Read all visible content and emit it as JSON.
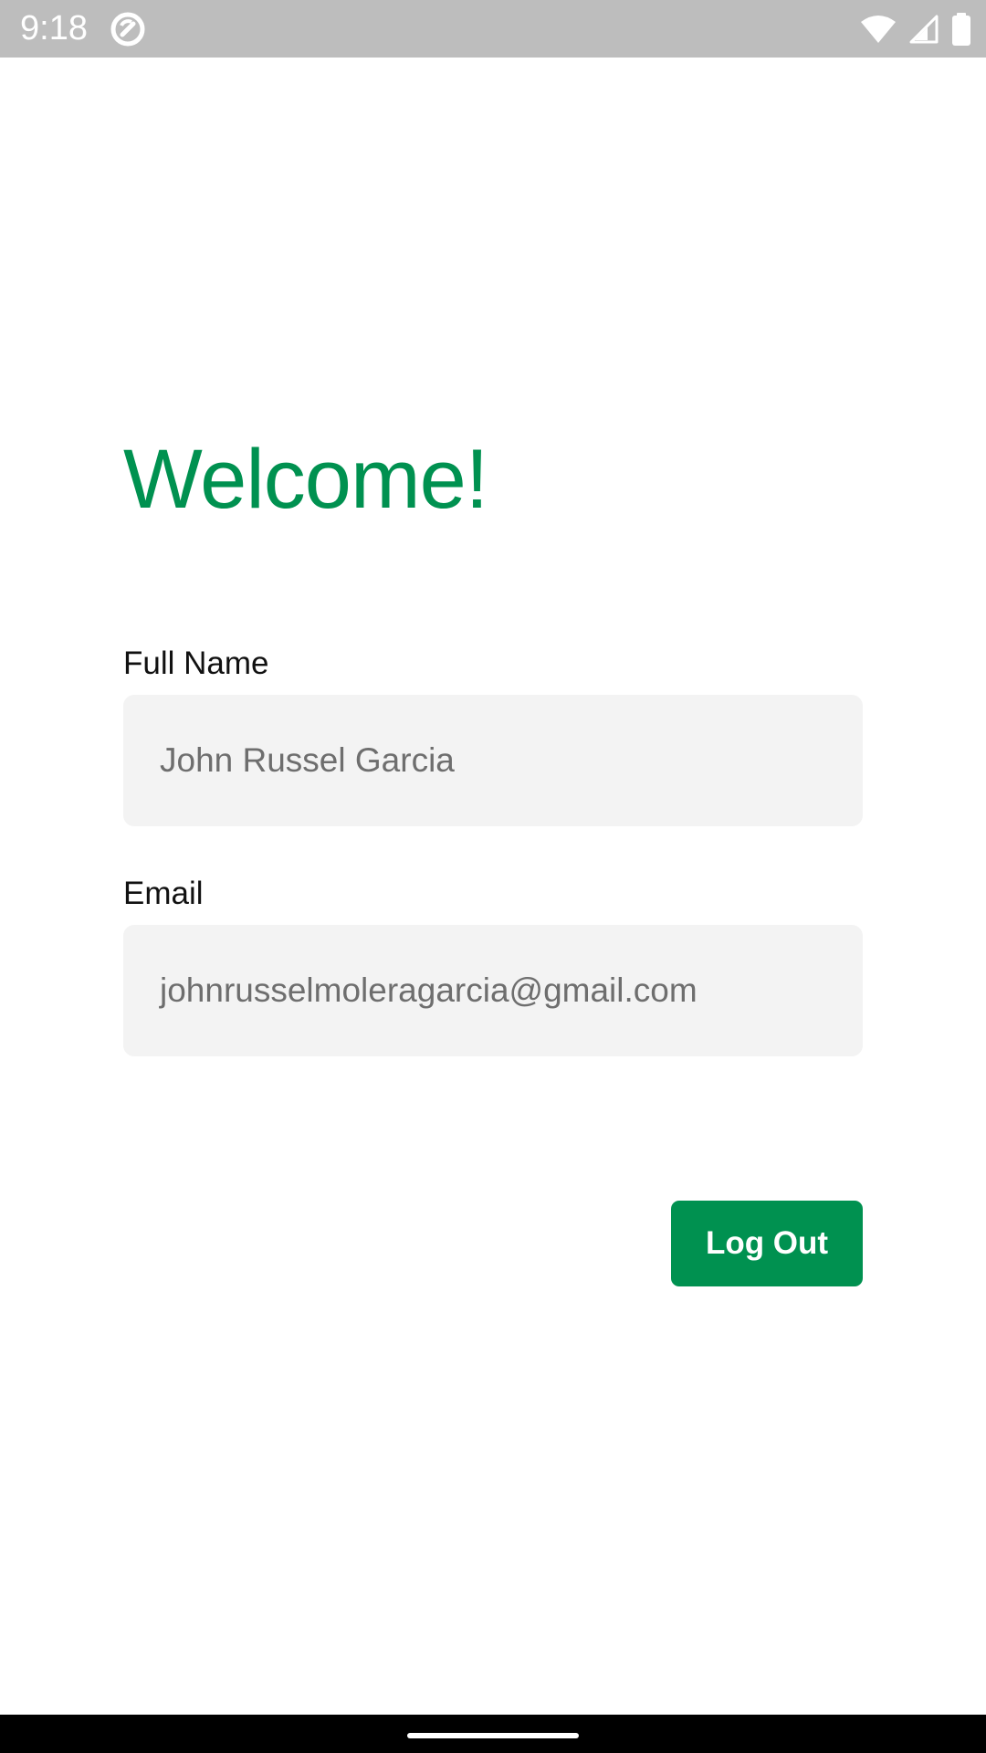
{
  "status_bar": {
    "time": "9:18",
    "app_icon": "no-sync-icon",
    "icons": [
      "wifi-icon",
      "signal-icon",
      "battery-icon"
    ]
  },
  "main": {
    "title": "Welcome!",
    "fields": [
      {
        "label": "Full Name",
        "value": "John Russel Garcia"
      },
      {
        "label": "Email",
        "value": "johnrusselmoleragarcia@gmail.com"
      }
    ],
    "logout_label": "Log Out"
  },
  "colors": {
    "accent": "#009150",
    "field_background": "#f3f3f3",
    "status_bar": "#bdbdbd"
  }
}
